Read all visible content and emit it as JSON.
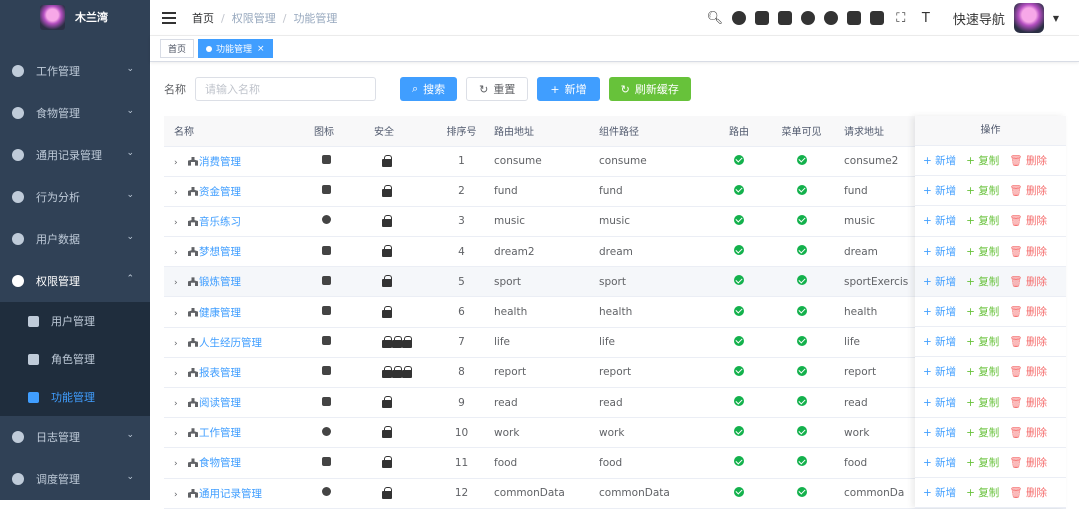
{
  "sidebar": {
    "app_name": "木兰湾",
    "menus": [
      {
        "label": "工作管理"
      },
      {
        "label": "食物管理"
      },
      {
        "label": "通用记录管理"
      },
      {
        "label": "行为分析"
      },
      {
        "label": "用户数据"
      },
      {
        "label": "权限管理"
      },
      {
        "label": "日志管理"
      },
      {
        "label": "调度管理"
      }
    ],
    "submenu": [
      {
        "label": "用户管理"
      },
      {
        "label": "角色管理"
      },
      {
        "label": "功能管理"
      }
    ]
  },
  "navbar": {
    "breadcrumb": [
      "首页",
      "权限管理",
      "功能管理"
    ],
    "separator": "/",
    "quick_nav": "快速导航"
  },
  "tags": [
    {
      "label": "首页"
    },
    {
      "label": "功能管理",
      "close": "×"
    }
  ],
  "search": {
    "label": "名称",
    "placeholder": "请输入名称",
    "buttons": {
      "search": "搜索",
      "reset": "重置",
      "add": "新增",
      "refresh": "刷新缓存"
    }
  },
  "table": {
    "headers": [
      "名称",
      "图标",
      "安全",
      "排序号",
      "路由地址",
      "组件路径",
      "路由",
      "菜单可见",
      "请求地址",
      "操作"
    ],
    "rows": [
      {
        "name": "消费管理",
        "order": "1",
        "path": "consume",
        "component": "consume",
        "url": "consume2"
      },
      {
        "name": "资金管理",
        "order": "2",
        "path": "fund",
        "component": "fund",
        "url": "fund"
      },
      {
        "name": "音乐练习",
        "order": "3",
        "path": "music",
        "component": "music",
        "url": "music"
      },
      {
        "name": "梦想管理",
        "order": "4",
        "path": "dream2",
        "component": "dream",
        "url": "dream"
      },
      {
        "name": "锻炼管理",
        "order": "5",
        "path": "sport",
        "component": "sport",
        "url": "sportExercis"
      },
      {
        "name": "健康管理",
        "order": "6",
        "path": "health",
        "component": "health",
        "url": "health"
      },
      {
        "name": "人生经历管理",
        "order": "7",
        "path": "life",
        "component": "life",
        "url": "life"
      },
      {
        "name": "报表管理",
        "order": "8",
        "path": "report",
        "component": "report",
        "url": "report"
      },
      {
        "name": "阅读管理",
        "order": "9",
        "path": "read",
        "component": "read",
        "url": "read"
      },
      {
        "name": "工作管理",
        "order": "10",
        "path": "work",
        "component": "work",
        "url": "work"
      },
      {
        "name": "食物管理",
        "order": "11",
        "path": "food",
        "component": "food",
        "url": "food"
      },
      {
        "name": "通用记录管理",
        "order": "12",
        "path": "commonData",
        "component": "commonData",
        "url": "commonDa"
      }
    ],
    "actions": {
      "add": "新增",
      "copy": "复制",
      "delete": "删除"
    }
  },
  "colors": {
    "sidebar_bg": "#304156",
    "primary": "#409eff",
    "success": "#67c23a",
    "danger": "#f56c6c"
  }
}
